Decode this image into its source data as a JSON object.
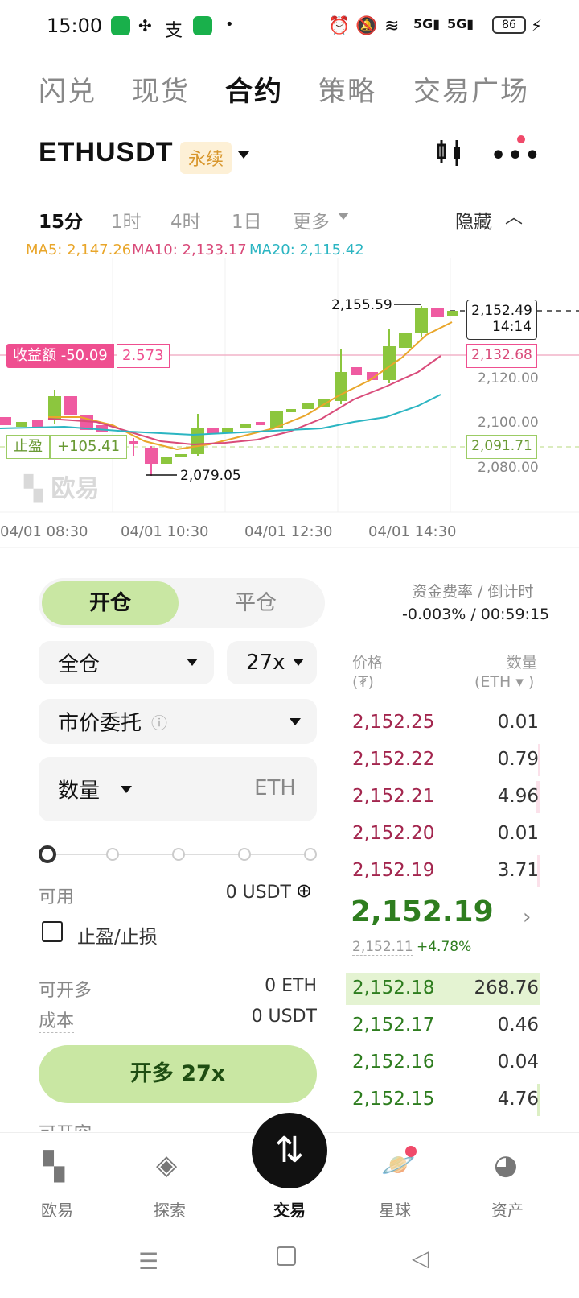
{
  "status_bar": {
    "time": "15:00",
    "battery": "86"
  },
  "top_tabs": [
    "闪兑",
    "现货",
    "合约",
    "策略",
    "交易广场"
  ],
  "instrument": {
    "symbol": "ETHUSDT",
    "type_badge": "永续"
  },
  "timeframes": {
    "items": [
      "15分",
      "1时",
      "4时",
      "1日",
      "更多"
    ],
    "active": "15分",
    "hide_label": "隐藏"
  },
  "chart": {
    "ma": [
      {
        "label": "MA5: 2,147.26",
        "color": "#e9a62a"
      },
      {
        "label": "MA10: 2,133.17",
        "color": "#d94b7a"
      },
      {
        "label": "MA20: 2,115.42",
        "color": "#2bb5c2"
      }
    ],
    "price_axis": [
      "2,120.00",
      "2,100.00",
      "2,080.00"
    ],
    "time_axis": [
      "04/01 08:30",
      "04/01 10:30",
      "04/01 12:30",
      "04/01 14:30"
    ],
    "high_label": "2,155.59",
    "low_label": "2,079.05",
    "last_price_tag": "2,152.49",
    "countdown_tag": "14:14",
    "pnl_label": "收益额 -50.09",
    "pnl_value": "2.573",
    "pnl_price_tag": "2,132.68",
    "tp_label": "止盈",
    "tp_value": "+105.41",
    "tp_price_tag": "2,091.71",
    "watermark": "欧易"
  },
  "trade_panel": {
    "open_tab": "开仓",
    "close_tab": "平仓",
    "margin_mode": "全仓",
    "leverage": "27x",
    "order_type": "市价委托",
    "quantity_label": "数量",
    "quantity_unit": "ETH",
    "available_label": "可用",
    "available_value": "0 USDT",
    "tpsl_label": "止盈/止损",
    "can_open_long_label": "可开多",
    "can_open_long_value": "0 ETH",
    "cost_label": "成本",
    "cost_value": "0 USDT",
    "submit_label": "开多 27x",
    "partial_label": "可开空"
  },
  "orderbook": {
    "funding_label": "资金费率 / 倒计时",
    "funding_value": "-0.003% / 00:59:15",
    "price_header": "价格",
    "price_unit": "(₮)",
    "qty_header": "数量",
    "qty_unit": "(ETH ▾ )",
    "asks": [
      {
        "price": "2,152.25",
        "qty": "0.01"
      },
      {
        "price": "2,152.22",
        "qty": "0.79"
      },
      {
        "price": "2,152.21",
        "qty": "4.96"
      },
      {
        "price": "2,152.20",
        "qty": "0.01"
      },
      {
        "price": "2,152.19",
        "qty": "3.71"
      }
    ],
    "last_price": "2,152.19",
    "mark_price": "2,152.11",
    "change": "+4.78%",
    "bids": [
      {
        "price": "2,152.18",
        "qty": "268.76"
      },
      {
        "price": "2,152.17",
        "qty": "0.46"
      },
      {
        "price": "2,152.16",
        "qty": "0.04"
      },
      {
        "price": "2,152.15",
        "qty": "4.76"
      }
    ]
  },
  "bottom_nav": [
    "欧易",
    "探索",
    "交易",
    "星球",
    "资产"
  ]
}
